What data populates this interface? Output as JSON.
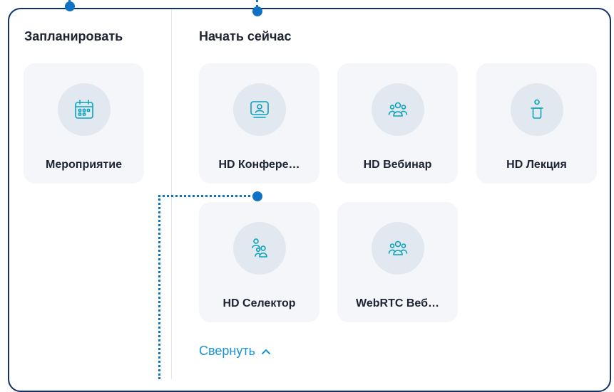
{
  "schedule": {
    "heading": "Запланировать",
    "cards": [
      {
        "label": "Мероприятие",
        "icon": "calendar-icon"
      }
    ]
  },
  "start_now": {
    "heading": "Начать сейчас",
    "cards": [
      {
        "label": "HD Конфере…",
        "icon": "conference-screen-icon"
      },
      {
        "label": "HD Вебинар",
        "icon": "webinar-group-icon"
      },
      {
        "label": "HD Лекция",
        "icon": "lecture-podium-icon"
      },
      {
        "label": "HD Селектор",
        "icon": "selector-group-icon"
      },
      {
        "label": "WebRTC Веб…",
        "icon": "webinar-group-icon"
      }
    ],
    "collapse_label": "Свернуть",
    "collapse_icon": "chevron-up-icon"
  },
  "colors": {
    "border": "#13306e",
    "accent": "#1a93d8",
    "icon": "#0aa3bd",
    "annotation": "#0f72c2"
  }
}
